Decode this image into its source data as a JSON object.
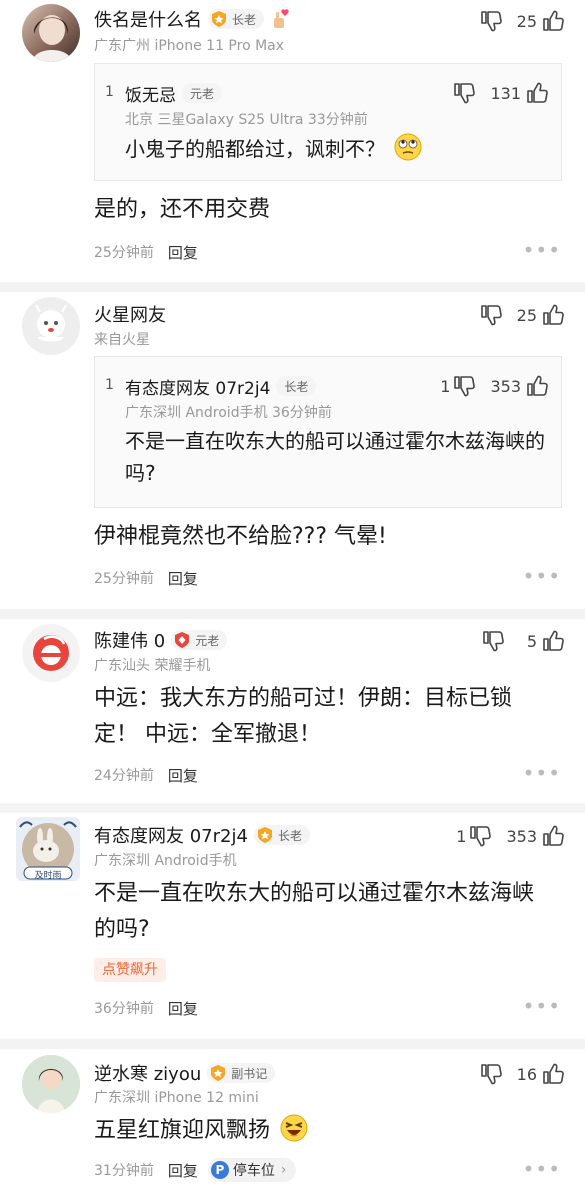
{
  "comments": [
    {
      "name": "佚名是什么名",
      "badge": "长老",
      "meta": "广东广州  iPhone 11 Pro Max",
      "up_count": "25",
      "quote": {
        "index": "1",
        "name": "饭无忌",
        "badge": "元老",
        "meta": "北京  三星Galaxy S25 Ultra  33分钟前",
        "up_count": "131",
        "text": "小鬼子的船都给过，讽刺不？"
      },
      "text": "是的，还不用交费",
      "time": "25分钟前",
      "reply": "回复"
    },
    {
      "name": "火星网友",
      "meta": "来自火星",
      "up_count": "25",
      "quote": {
        "index": "1",
        "name": "有态度网友 07r2j4",
        "badge": "长老",
        "meta": "广东深圳  Android手机  36分钟前",
        "down_count": "1",
        "up_count": "353",
        "text": "不是一直在吹东大的船可以通过霍尔木兹海峡的吗?"
      },
      "text": "伊神棍竟然也不给脸???  气晕!",
      "time": "25分钟前",
      "reply": "回复"
    },
    {
      "name": "陈建伟 0",
      "badge": "元老",
      "meta": "广东汕头  荣耀手机",
      "up_count": "5",
      "text": "中远：我大东方的船可过！伊朗：目标已锁定！ 中远：全军撤退！",
      "time": "24分钟前",
      "reply": "回复"
    },
    {
      "name": "有态度网友 07r2j4",
      "badge": "长老",
      "meta": "广东深圳  Android手机",
      "down_count": "1",
      "up_count": "353",
      "text": "不是一直在吹东大的船可以通过霍尔木兹海峡的吗?",
      "tag": "点赞飙升",
      "avatar_caption": "及时雨",
      "time": "36分钟前",
      "reply": "回复"
    },
    {
      "name": "逆水寒 ziyou",
      "badge": "副书记",
      "meta": "广东深圳  iPhone 12 mini",
      "up_count": "16",
      "text": "五星红旗迎风飘扬",
      "time": "31分钟前",
      "reply": "回复",
      "parking": "停车位"
    }
  ],
  "more_glyph": "•••",
  "colors": {
    "badge_gold": "#f5a623",
    "badge_red": "#e8453c",
    "tag_orange": "#f0663a",
    "meta_gray": "#999999"
  }
}
